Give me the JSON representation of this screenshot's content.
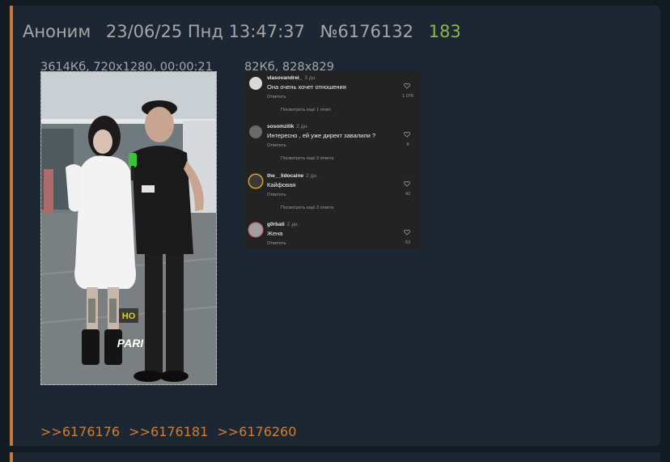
{
  "post": {
    "author": "Аноним",
    "date": "23/06/25 Пнд 13:47:37",
    "number": "№6176132",
    "reply_count": "183"
  },
  "files": [
    {
      "info": "3614Кб, 720x1280, 00:00:21",
      "watermark": "PARI",
      "badge": "HO"
    },
    {
      "info": "82Кб, 828x829"
    }
  ],
  "comments": [
    {
      "user": "vlasovandrei_",
      "time": "3 дн.",
      "text": "Она очень хочет отношения",
      "reply": "Ответить",
      "likes": "1 076",
      "more": "Посмотреть ещё 1 ответ"
    },
    {
      "user": "sosomzilik",
      "time": "2 дн.",
      "text": "Интересно , ей уже директ завалили ?",
      "reply": "Ответить",
      "likes": "8",
      "more": "Посмотреть ещё 3 ответа"
    },
    {
      "user": "the__lidocaine",
      "time": "2 дн.",
      "text": "Кайфовая",
      "reply": "Ответить",
      "likes": "42",
      "more": "Посмотреть ещё 2 ответа"
    },
    {
      "user": "g0rbati",
      "time": "2 дн.",
      "text": "Жена",
      "reply": "Ответить",
      "likes": "53"
    }
  ],
  "replies": [
    ">>6176176",
    ">>6176181",
    ">>6176260"
  ],
  "colors": {
    "accent": "#c8763a",
    "reply_link": "#d27d33",
    "count": "#8ab84a",
    "background": "#1d2733"
  }
}
